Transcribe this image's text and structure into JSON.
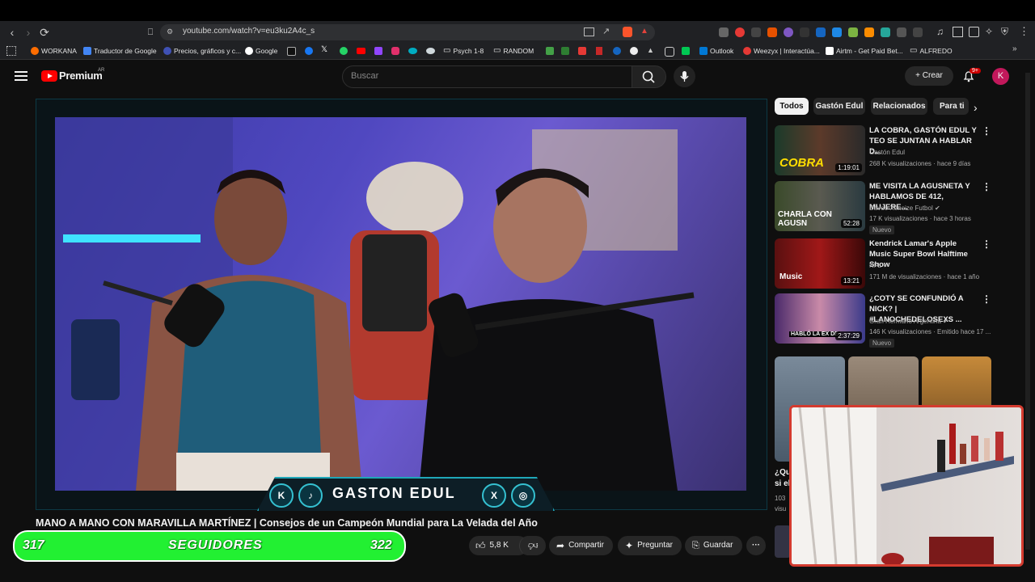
{
  "browser": {
    "url": "youtube.com/watch?v=eu3ku2A4c_s",
    "bookmarks": [
      "WORKANA",
      "Traductor de Google",
      "Precios, gráficos y c...",
      "Google",
      "Psych 1-8",
      "RANDOM",
      "Outlook",
      "Weezyx | Interactúa...",
      "Airtm - Get Paid Bet...",
      "ALFREDO"
    ]
  },
  "youtube": {
    "brand": "Premium",
    "country": "AR",
    "search_placeholder": "Buscar",
    "create_label": "Crear",
    "notif_badge": "9+",
    "avatar_letter": "K"
  },
  "video": {
    "overlay_name": "GASTON EDUL",
    "overlay_icons": [
      "K",
      "♪",
      "X",
      "◎"
    ],
    "title": "MANO A MANO CON MARAVILLA MARTÍNEZ | Consejos de un Campeón Mundial para La Velada del Año",
    "likes": "5,8 K",
    "share_label": "Compartir",
    "ask_label": "Preguntar",
    "save_label": "Guardar"
  },
  "followers": {
    "current": "317",
    "label": "SEGUIDORES",
    "goal": "322"
  },
  "chips": [
    "Todos",
    "Gastón Edul",
    "Relacionados",
    "Para ti"
  ],
  "related": [
    {
      "title": "LA COBRA, GASTÓN EDUL Y TEO SE JUNTAN A HABLAR D...",
      "channel": "Gastón Edul",
      "meta": "268 K visualizaciones · hace 9 días",
      "duration": "1:19:01",
      "thumb_text": "COBRA",
      "badge": ""
    },
    {
      "title": "ME VISITA LA AGUSNETA Y HABLAMOS DE 412, MUJERE...",
      "channel": "Davoo Xeneize Futbol",
      "meta": "17 K visualizaciones · hace 3 horas",
      "duration": "52:28",
      "thumb_text": "CHARLA CON AGUSN",
      "badge": "Nuevo"
    },
    {
      "title": "Kendrick Lamar's Apple Music Super Bowl Halftime Show",
      "channel": "NFL",
      "meta": "171 M de visualizaciones · hace 1 año",
      "duration": "13:21",
      "thumb_text": "Music",
      "badge": ""
    },
    {
      "title": "¿COTY SE CONFUNDIÓ A NICK? | #LANOCHEDELOSEXS ...",
      "channel": "Gran Hermano Argentina",
      "meta": "146 K visualizaciones · Emitido hace 17 ...",
      "duration": "2:37:29",
      "thumb_text": "HABLÓ LA EX DE",
      "badge": "Nuevo"
    }
  ],
  "partial_next": {
    "title": "¿Qu si el",
    "meta": "103 visu"
  }
}
